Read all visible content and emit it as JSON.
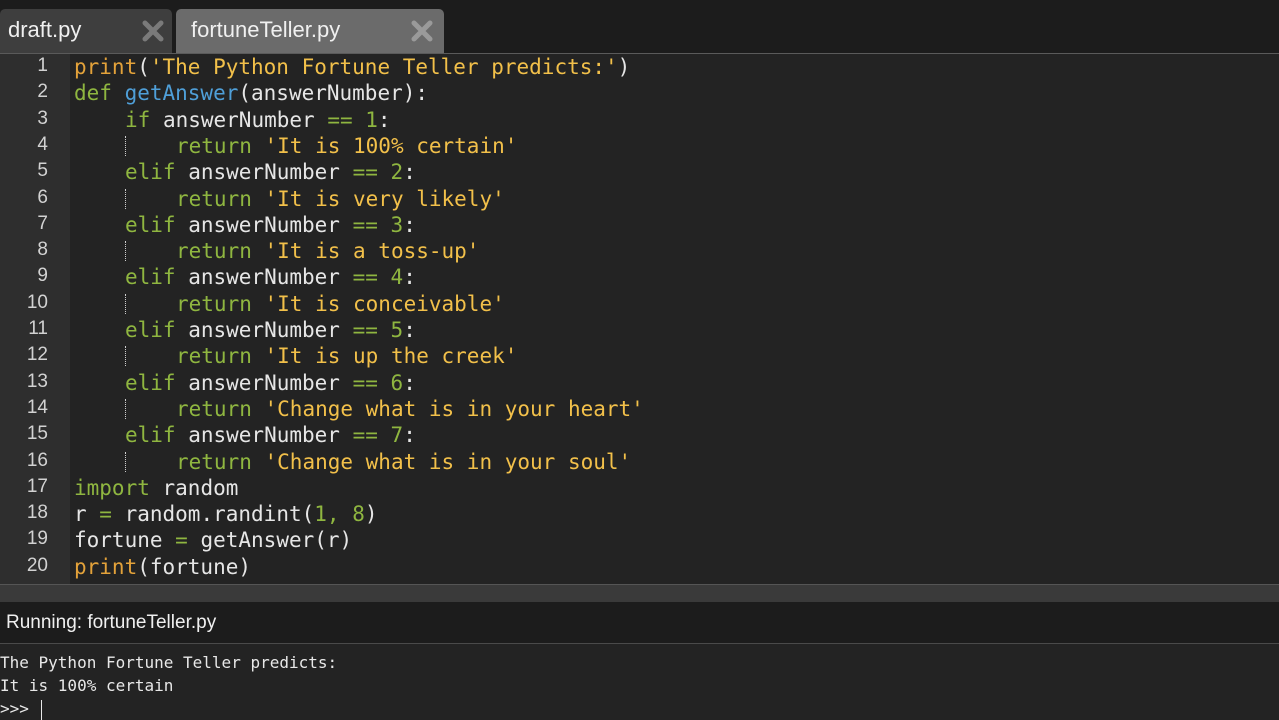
{
  "tabs": [
    {
      "label": "draft.py",
      "active": false,
      "close_icon": "close-x-icon"
    },
    {
      "label": "fortuneTeller.py",
      "active": true,
      "close_icon": "close-x-icon"
    }
  ],
  "editor": {
    "lines": [
      {
        "number": "1",
        "indent": 0,
        "tokens": [
          [
            "builtin",
            "print"
          ],
          [
            "name",
            "("
          ],
          [
            "string",
            "'The Python Fortune Teller predicts:'"
          ],
          [
            "name",
            ")"
          ]
        ]
      },
      {
        "number": "2",
        "indent": 0,
        "tokens": [
          [
            "keyword",
            "def "
          ],
          [
            "func",
            "getAnswer"
          ],
          [
            "name",
            "(answerNumber):"
          ]
        ]
      },
      {
        "number": "3",
        "indent": 1,
        "tokens": [
          [
            "keyword",
            "if "
          ],
          [
            "name",
            "answerNumber "
          ],
          [
            "op",
            "=="
          ],
          [
            "name",
            " "
          ],
          [
            "number",
            "1"
          ],
          [
            "name",
            ":"
          ]
        ]
      },
      {
        "number": "4",
        "indent": 2,
        "tokens": [
          [
            "keyword",
            "return "
          ],
          [
            "string",
            "'It is 100% certain'"
          ]
        ]
      },
      {
        "number": "5",
        "indent": 1,
        "tokens": [
          [
            "keyword",
            "elif "
          ],
          [
            "name",
            "answerNumber "
          ],
          [
            "op",
            "=="
          ],
          [
            "name",
            " "
          ],
          [
            "number",
            "2"
          ],
          [
            "name",
            ":"
          ]
        ]
      },
      {
        "number": "6",
        "indent": 2,
        "tokens": [
          [
            "keyword",
            "return "
          ],
          [
            "string",
            "'It is very likely'"
          ]
        ]
      },
      {
        "number": "7",
        "indent": 1,
        "tokens": [
          [
            "keyword",
            "elif "
          ],
          [
            "name",
            "answerNumber "
          ],
          [
            "op",
            "=="
          ],
          [
            "name",
            " "
          ],
          [
            "number",
            "3"
          ],
          [
            "name",
            ":"
          ]
        ]
      },
      {
        "number": "8",
        "indent": 2,
        "tokens": [
          [
            "keyword",
            "return "
          ],
          [
            "string",
            "'It is a toss-up'"
          ]
        ]
      },
      {
        "number": "9",
        "indent": 1,
        "tokens": [
          [
            "keyword",
            "elif "
          ],
          [
            "name",
            "answerNumber "
          ],
          [
            "op",
            "=="
          ],
          [
            "name",
            " "
          ],
          [
            "number",
            "4"
          ],
          [
            "name",
            ":"
          ]
        ]
      },
      {
        "number": "10",
        "indent": 2,
        "tokens": [
          [
            "keyword",
            "return "
          ],
          [
            "string",
            "'It is conceivable'"
          ]
        ]
      },
      {
        "number": "11",
        "indent": 1,
        "tokens": [
          [
            "keyword",
            "elif "
          ],
          [
            "name",
            "answerNumber "
          ],
          [
            "op",
            "=="
          ],
          [
            "name",
            " "
          ],
          [
            "number",
            "5"
          ],
          [
            "name",
            ":"
          ]
        ]
      },
      {
        "number": "12",
        "indent": 2,
        "tokens": [
          [
            "keyword",
            "return "
          ],
          [
            "string",
            "'It is up the creek'"
          ]
        ]
      },
      {
        "number": "13",
        "indent": 1,
        "tokens": [
          [
            "keyword",
            "elif "
          ],
          [
            "name",
            "answerNumber "
          ],
          [
            "op",
            "=="
          ],
          [
            "name",
            " "
          ],
          [
            "number",
            "6"
          ],
          [
            "name",
            ":"
          ]
        ]
      },
      {
        "number": "14",
        "indent": 2,
        "tokens": [
          [
            "keyword",
            "return "
          ],
          [
            "string",
            "'Change what is in your heart'"
          ]
        ]
      },
      {
        "number": "15",
        "indent": 1,
        "tokens": [
          [
            "keyword",
            "elif "
          ],
          [
            "name",
            "answerNumber "
          ],
          [
            "op",
            "=="
          ],
          [
            "name",
            " "
          ],
          [
            "number",
            "7"
          ],
          [
            "name",
            ":"
          ]
        ]
      },
      {
        "number": "16",
        "indent": 2,
        "tokens": [
          [
            "keyword",
            "return "
          ],
          [
            "string",
            "'Change what is in your soul'"
          ]
        ]
      },
      {
        "number": "17",
        "indent": 0,
        "tokens": [
          [
            "keyword",
            "import "
          ],
          [
            "name",
            "random"
          ]
        ]
      },
      {
        "number": "18",
        "indent": 0,
        "tokens": [
          [
            "name",
            "r "
          ],
          [
            "op",
            "="
          ],
          [
            "name",
            " random.randint("
          ],
          [
            "number",
            "1"
          ],
          [
            "op",
            ","
          ],
          [
            "name",
            " "
          ],
          [
            "number",
            "8"
          ],
          [
            "name",
            ")"
          ]
        ]
      },
      {
        "number": "19",
        "indent": 0,
        "tokens": [
          [
            "name",
            "fortune "
          ],
          [
            "op",
            "="
          ],
          [
            "name",
            " getAnswer(r)"
          ]
        ]
      },
      {
        "number": "20",
        "indent": 0,
        "tokens": [
          [
            "builtin",
            "print"
          ],
          [
            "name",
            "(fortune)"
          ]
        ]
      }
    ]
  },
  "console": {
    "title": "Running: fortuneTeller.py",
    "output": [
      "The Python Fortune Teller predicts:",
      "It is 100% certain"
    ],
    "prompt": ">>> "
  },
  "colors": {
    "builtin": "#e3a23a",
    "keyword": "#8fb640",
    "function": "#4f9fd8",
    "string": "#f2c04a",
    "background": "#232323",
    "gutter": "#2e2e2e",
    "active_tab": "#6b6b6b",
    "inactive_tab": "#3e3e3e"
  }
}
